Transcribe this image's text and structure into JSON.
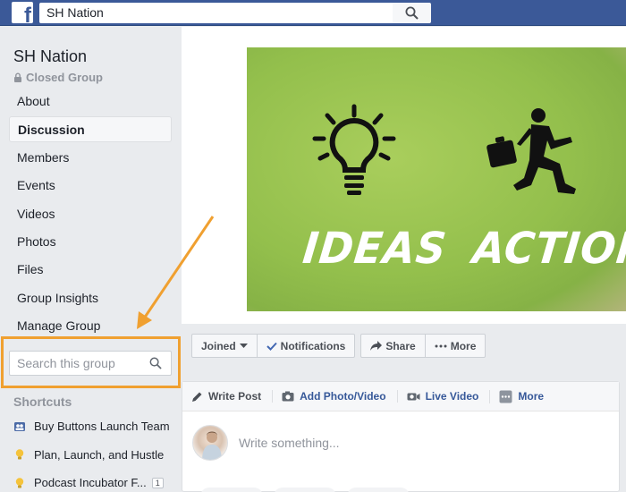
{
  "topbar": {
    "logo_letter": "f",
    "search_value": "SH Nation"
  },
  "sidebar": {
    "group_name": "SH Nation",
    "privacy": "Closed Group",
    "nav": [
      {
        "label": "About"
      },
      {
        "label": "Discussion",
        "active": true
      },
      {
        "label": "Members"
      },
      {
        "label": "Events"
      },
      {
        "label": "Videos"
      },
      {
        "label": "Photos"
      },
      {
        "label": "Files"
      },
      {
        "label": "Group Insights"
      },
      {
        "label": "Manage Group"
      }
    ],
    "search_placeholder": "Search this group",
    "shortcuts_title": "Shortcuts",
    "shortcuts": [
      {
        "label": "Buy Buttons Launch Team",
        "icon": "group-icon"
      },
      {
        "label": "Plan, Launch, and Hustle",
        "icon": "lightbulb-icon"
      },
      {
        "label": "Podcast Incubator F...",
        "icon": "lightbulb-icon",
        "badge": "1"
      }
    ]
  },
  "cover": {
    "left_word": "IDEAS",
    "right_word": "ACTION"
  },
  "actions": {
    "joined": "Joined",
    "notifications": "Notifications",
    "share": "Share",
    "more": "More"
  },
  "composer": {
    "tabs": {
      "write_post": "Write Post",
      "add_photo": "Add Photo/Video",
      "live_video": "Live Video",
      "more": "More"
    },
    "placeholder": "Write something..."
  },
  "colors": {
    "facebook_blue": "#3b5998",
    "link_blue": "#365899",
    "annotation_orange": "#f0a030",
    "cover_green": "#93bf4c"
  }
}
